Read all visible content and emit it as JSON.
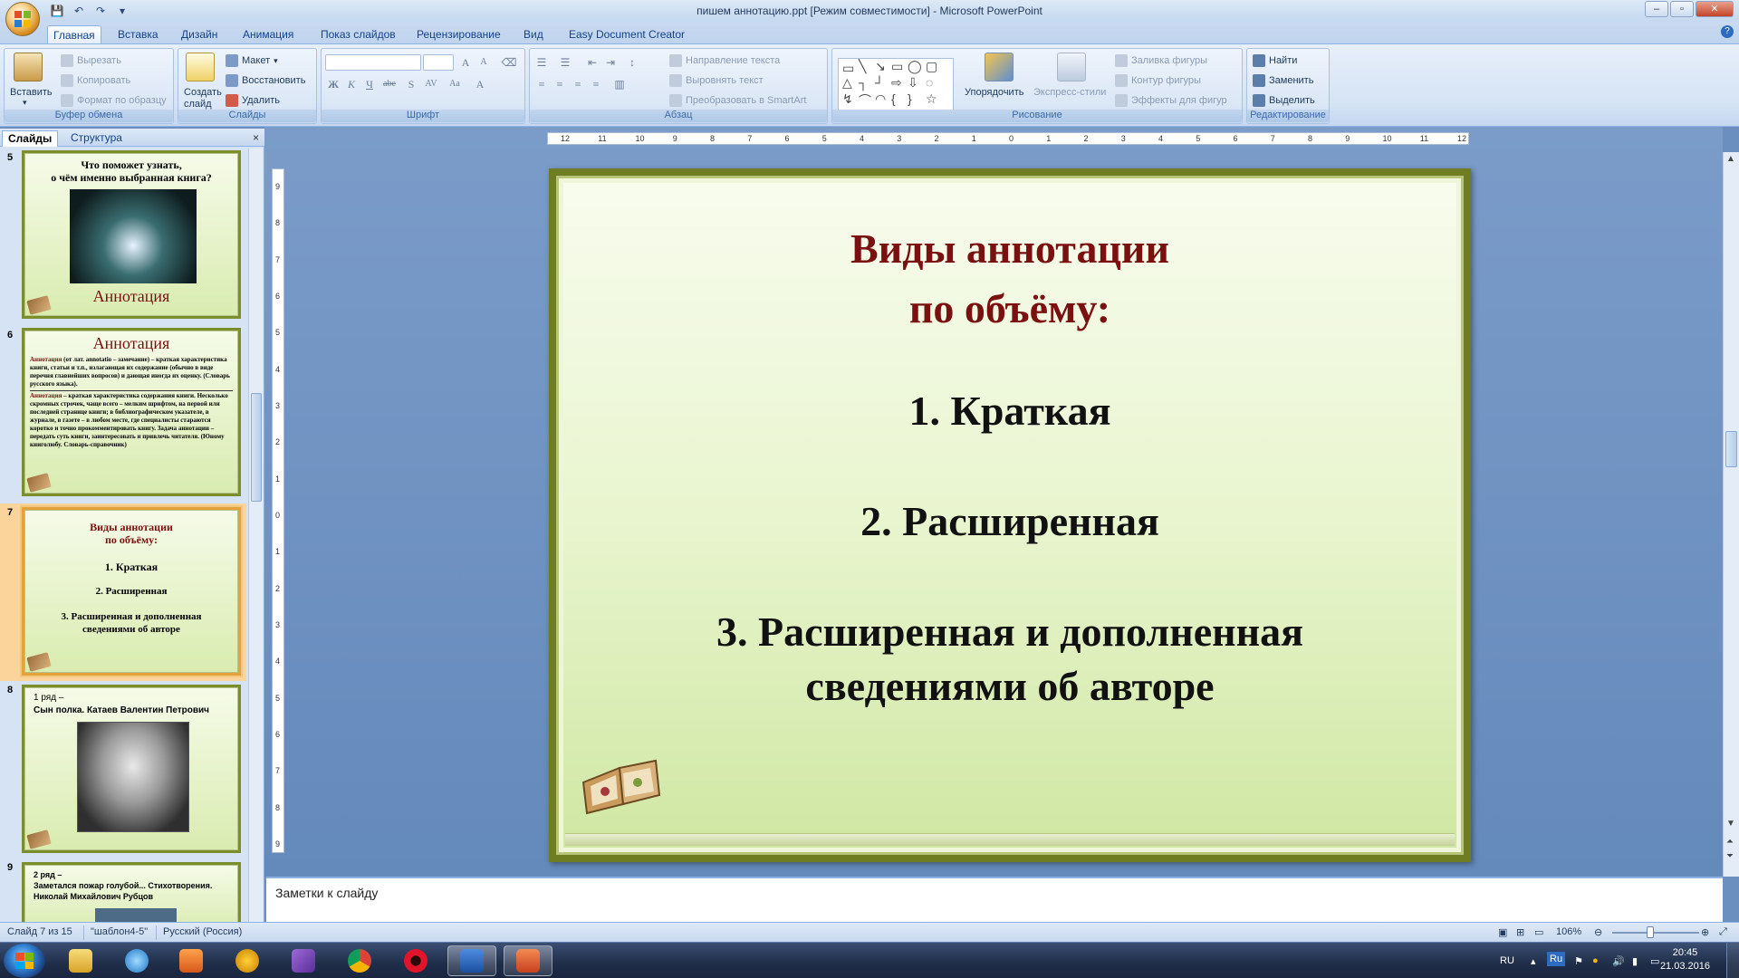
{
  "window": {
    "title": "пишем аннотацию.ppt [Режим совместимости] - Microsoft PowerPoint",
    "controls": {
      "minimize": "–",
      "maximize": "▫",
      "close": "✕"
    }
  },
  "qat": {
    "save": "💾",
    "undo": "↶",
    "redo": "↷",
    "customize": "▾"
  },
  "tabs": [
    "Главная",
    "Вставка",
    "Дизайн",
    "Анимация",
    "Показ слайдов",
    "Рецензирование",
    "Вид",
    "Easy Document Creator"
  ],
  "ribbon": {
    "clipboard": {
      "label": "Буфер обмена",
      "paste": "Вставить",
      "cut": "Вырезать",
      "copy": "Копировать",
      "format_painter": "Формат по образцу"
    },
    "slides": {
      "label": "Слайды",
      "new_slide": "Создать слайд",
      "layout": "Макет",
      "reset": "Восстановить",
      "delete": "Удалить"
    },
    "font": {
      "label": "Шрифт"
    },
    "paragraph": {
      "label": "Абзац",
      "text_direction": "Направление текста",
      "align_text": "Выровнять текст",
      "smartart": "Преобразовать в SmartArt"
    },
    "drawing": {
      "label": "Рисование",
      "arrange": "Упорядочить",
      "quick_styles": "Экспресс-стили",
      "fill": "Заливка фигуры",
      "outline": "Контур фигуры",
      "effects": "Эффекты для фигур"
    },
    "editing": {
      "label": "Редактирование",
      "find": "Найти",
      "replace": "Заменить",
      "select": "Выделить"
    }
  },
  "left_panel": {
    "tab_slides": "Слайды",
    "tab_outline": "Структура",
    "close": "×",
    "slides": [
      {
        "number": "5",
        "title": "Что поможет узнать,",
        "title2": "о чём именно выбранная книга?",
        "caption": "Аннотация"
      },
      {
        "number": "6",
        "title": "Аннотация",
        "body1_term": "Аннотация",
        "body1": " (от лат. annotatio – замечание) – краткая характеристика книги, статьи и т.п., излагающая их содержание (обычно в виде перечня главнейших вопросов) и дающая иногда их оценку. (Словарь русского языка).",
        "body2_term": "Аннотация",
        "body2": " – краткая характеристика содержания книги. Несколько скромных строчек, чаще всего – мелким шрифтом, на первой или последней странице книги; в библиографическом указателе, в журнале, в газете – в любом месте, где специалисты стараются коротко и точно прокомментировать книгу. Задача аннотации – передать суть книги, заинтересовать и привлечь читателя. (Юному книголюбу. Словарь-справочник)"
      },
      {
        "number": "7",
        "title": "Виды аннотации",
        "title2": "по объёму:",
        "item1": "1.  Краткая",
        "item2": "2. Расширенная",
        "item3": "3. Расширенная и дополненная",
        "item3b": "сведениями об авторе"
      },
      {
        "number": "8",
        "title": "1 ряд –",
        "title2": "Сын полка. Катаев Валентин Петрович"
      },
      {
        "number": "9",
        "title": "2 ряд –",
        "title2": "Заметался пожар голубой... Стихотворения.",
        "title3": "Николай Михайлович Рубцов"
      }
    ]
  },
  "slide": {
    "heading_line1": "Виды аннотации",
    "heading_line2": "по объёму:",
    "item1": "1.  Краткая",
    "item2": "2. Расширенная",
    "item3_line1": "3. Расширенная и дополненная",
    "item3_line2": "сведениями об авторе"
  },
  "rulers": {
    "h_ticks": [
      "12",
      "11",
      "10",
      "9",
      "8",
      "7",
      "6",
      "5",
      "4",
      "3",
      "2",
      "1",
      "0",
      "1",
      "2",
      "3",
      "4",
      "5",
      "6",
      "7",
      "8",
      "9",
      "10",
      "11",
      "12"
    ],
    "v_ticks": [
      "9",
      "8",
      "7",
      "6",
      "5",
      "4",
      "3",
      "2",
      "1",
      "0",
      "1",
      "2",
      "3",
      "4",
      "5",
      "6",
      "7",
      "8",
      "9"
    ]
  },
  "notes": {
    "placeholder": "Заметки к слайду"
  },
  "status": {
    "slide_info": "Слайд 7 из 15",
    "theme": "\"шаблон4-5\"",
    "language": "Русский (Россия)",
    "zoom": "106%"
  },
  "taskbar": {
    "lang": "RU",
    "time": "20:45",
    "date": "21.03.2016"
  },
  "colors": {
    "slide_heading": "#7a1010",
    "slide_text": "#111111",
    "slide_border": "#6f7d22",
    "ribbon_bg": "#d6e4f5",
    "selected_thumb": "#fbd49b"
  }
}
